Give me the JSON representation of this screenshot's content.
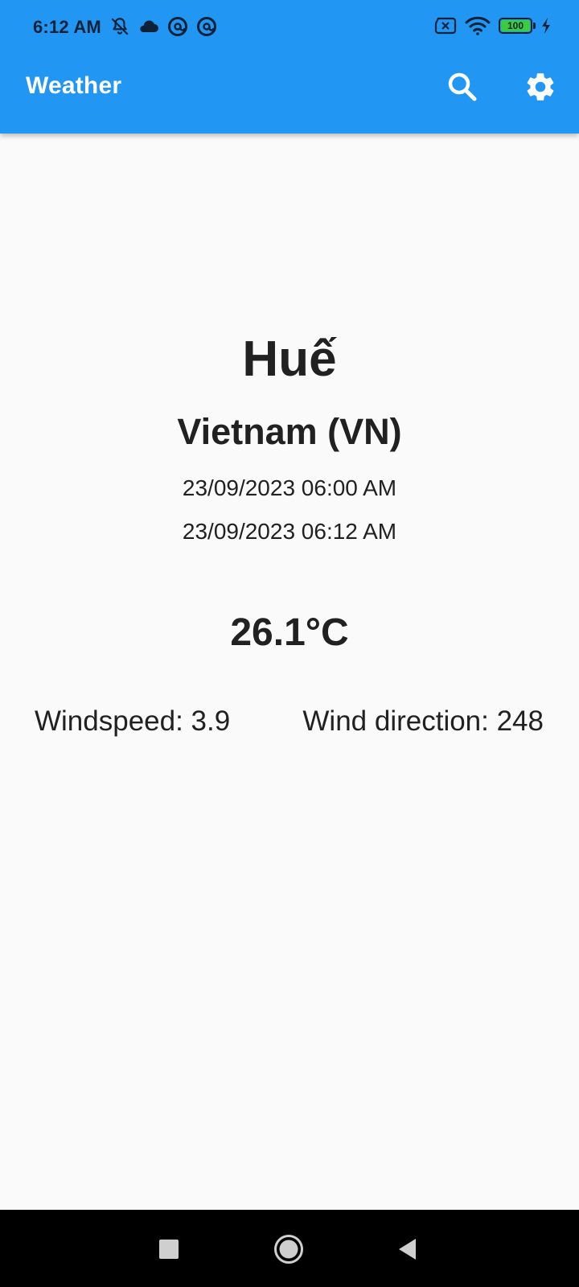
{
  "status_bar": {
    "time": "6:12 AM",
    "left_icons": [
      "notifications-off-icon",
      "cloud-icon",
      "app-at-icon",
      "app-at-icon"
    ],
    "right_icons": [
      "sim-off-icon",
      "wifi-icon",
      "battery-icon",
      "charging-icon"
    ],
    "battery_level": "100"
  },
  "app_bar": {
    "title": "Weather",
    "actions": [
      "search-icon",
      "settings-icon"
    ],
    "background_color": "#2196f3"
  },
  "weather": {
    "city": "Huế",
    "country": "Vietnam (VN)",
    "date_1": "23/09/2023 06:00 AM",
    "date_2": "23/09/2023 06:12 AM",
    "temperature": "26.1°C",
    "windspeed": "Windspeed: 3.9",
    "wind_direction": "Wind direction: 248"
  },
  "nav_bar": {
    "buttons": [
      "recents-icon",
      "home-icon",
      "back-icon"
    ]
  }
}
